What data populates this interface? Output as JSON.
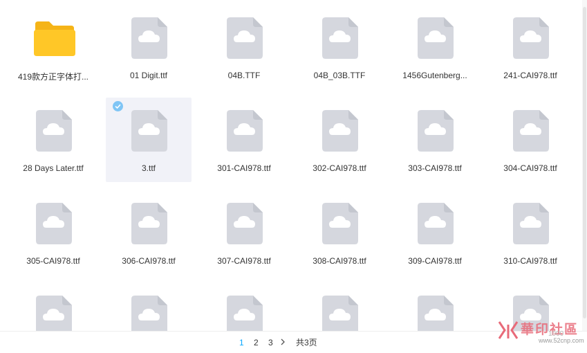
{
  "files": [
    {
      "name": "419款方正字体打...",
      "type": "folder",
      "selected": false
    },
    {
      "name": "01 Digit.ttf",
      "type": "file",
      "selected": false
    },
    {
      "name": "04B.TTF",
      "type": "file",
      "selected": false
    },
    {
      "name": "04B_03B.TTF",
      "type": "file",
      "selected": false
    },
    {
      "name": "1456Gutenberg...",
      "type": "file",
      "selected": false
    },
    {
      "name": "241-CAI978.ttf",
      "type": "file",
      "selected": false
    },
    {
      "name": "28 Days Later.ttf",
      "type": "file",
      "selected": false
    },
    {
      "name": "3.ttf",
      "type": "file",
      "selected": true
    },
    {
      "name": "301-CAI978.ttf",
      "type": "file",
      "selected": false
    },
    {
      "name": "302-CAI978.ttf",
      "type": "file",
      "selected": false
    },
    {
      "name": "303-CAI978.ttf",
      "type": "file",
      "selected": false
    },
    {
      "name": "304-CAI978.ttf",
      "type": "file",
      "selected": false
    },
    {
      "name": "305-CAI978.ttf",
      "type": "file",
      "selected": false
    },
    {
      "name": "306-CAI978.ttf",
      "type": "file",
      "selected": false
    },
    {
      "name": "307-CAI978.ttf",
      "type": "file",
      "selected": false
    },
    {
      "name": "308-CAI978.ttf",
      "type": "file",
      "selected": false
    },
    {
      "name": "309-CAI978.ttf",
      "type": "file",
      "selected": false
    },
    {
      "name": "310-CAI978.ttf",
      "type": "file",
      "selected": false
    },
    {
      "name": "",
      "type": "file",
      "selected": false
    },
    {
      "name": "",
      "type": "file",
      "selected": false
    },
    {
      "name": "",
      "type": "file",
      "selected": false
    },
    {
      "name": "",
      "type": "file",
      "selected": false
    },
    {
      "name": "",
      "type": "file",
      "selected": false
    },
    {
      "name": "",
      "type": "file",
      "selected": false
    }
  ],
  "pagination": {
    "pages": [
      "1",
      "2",
      "3"
    ],
    "current": "1",
    "next_icon": "chevron-right-icon",
    "total": "共3页"
  },
  "watermark": {
    "text": "華印社區",
    "count": "1000",
    "url": "www.52cnp.com"
  },
  "colors": {
    "accent": "#06a7ff",
    "selected_bg": "#f1f2f8",
    "file_icon": "#d5d7de",
    "folder": "#ffc727"
  }
}
